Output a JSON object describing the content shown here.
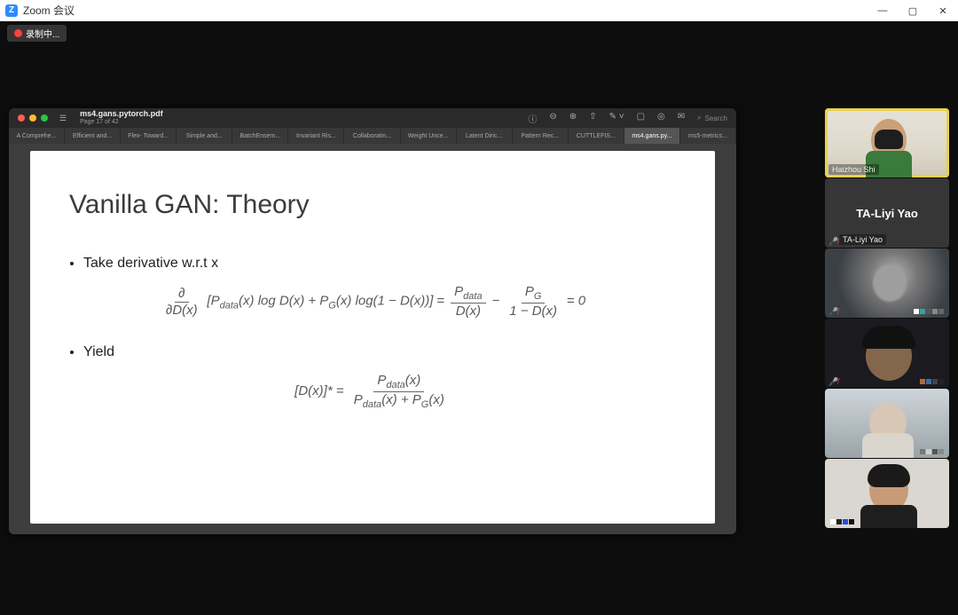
{
  "window": {
    "app_title": "Zoom 会议",
    "controls": {
      "min": "—",
      "max": "▢",
      "close": "✕"
    }
  },
  "recording": {
    "label": "录制中..."
  },
  "pdf_viewer": {
    "doc_title": "ms4.gans.pytorch.pdf",
    "page_indicator": "Page 17 of 42",
    "toolbar_icons": [
      "ⓘ",
      "⊖",
      "⊕",
      "⇧",
      "✎ ˅",
      "▢",
      "◎",
      "✉"
    ],
    "search_icon": "⌕",
    "search_placeholder": "Search",
    "tabs": [
      {
        "label": "A Comprehe...",
        "active": false
      },
      {
        "label": "Efficient and...",
        "active": false
      },
      {
        "label": "Flex- Toward...",
        "active": false
      },
      {
        "label": "Simple and...",
        "active": false
      },
      {
        "label": "BatchEnsem...",
        "active": false
      },
      {
        "label": "Invariant Ris...",
        "active": false
      },
      {
        "label": "Collaboratin...",
        "active": false
      },
      {
        "label": "Weight Unce...",
        "active": false
      },
      {
        "label": "Latent Diric...",
        "active": false
      },
      {
        "label": "Pattern Rec...",
        "active": false
      },
      {
        "label": "CUTTLEFIS...",
        "active": false
      },
      {
        "label": "ms4.gans.py...",
        "active": true
      },
      {
        "label": "ms5-metrics...",
        "active": false
      }
    ]
  },
  "slide": {
    "title": "Vanilla GAN: Theory",
    "bullet1": "Take derivative w.r.t x",
    "bullet2": "Yield",
    "eq1_lhs_num": "∂",
    "eq1_lhs_den": "∂D(x)",
    "eq1_bracket_open": "[",
    "eq1_term1a": "P",
    "eq1_term1a_sub": "data",
    "eq1_term1b": "(x) log D(x) + P",
    "eq1_term1b_sub": "G",
    "eq1_term1c": "(x) log(1 − D(x))",
    "eq1_bracket_close": "]",
    "eq1_eq": " = ",
    "eq1_r1_num_a": "P",
    "eq1_r1_num_sub": "data",
    "eq1_r1_den": "D(x)",
    "eq1_minus": " − ",
    "eq1_r2_num_a": "P",
    "eq1_r2_num_sub": "G",
    "eq1_r2_den": "1 − D(x)",
    "eq1_zero": " = 0",
    "eq2_lhs": "[D(x)]* = ",
    "eq2_num_a": "P",
    "eq2_num_sub": "data",
    "eq2_num_b": "(x)",
    "eq2_den_a": "P",
    "eq2_den_sub1": "data",
    "eq2_den_b": "(x) + P",
    "eq2_den_sub2": "G",
    "eq2_den_c": "(x)"
  },
  "participants": {
    "tiles": [
      {
        "name": "Haizhou Shi",
        "speaking": true,
        "muted": false,
        "camera_on": true
      },
      {
        "center_name": "TA-Liyi Yao",
        "name": "TA-Liyi Yao",
        "speaking": false,
        "muted": true,
        "camera_on": false
      },
      {
        "name": "",
        "speaking": false,
        "muted": true,
        "camera_on": true
      },
      {
        "name": "",
        "speaking": false,
        "muted": true,
        "camera_on": true
      },
      {
        "name": "",
        "speaking": false,
        "muted": false,
        "camera_on": true
      },
      {
        "name": "",
        "speaking": false,
        "muted": false,
        "camera_on": true
      }
    ]
  }
}
